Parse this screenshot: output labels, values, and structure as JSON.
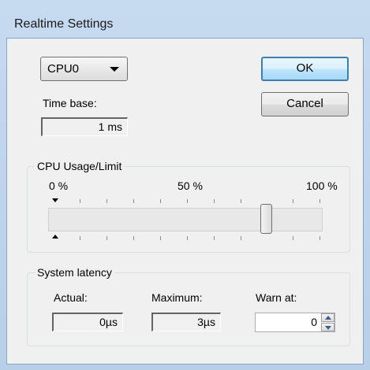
{
  "window": {
    "title": "Realtime Settings"
  },
  "cpu_select": {
    "selected": "CPU0"
  },
  "buttons": {
    "ok": "OK",
    "cancel": "Cancel"
  },
  "time_base": {
    "label": "Time base:",
    "value": "1 ms"
  },
  "cpu_usage": {
    "group_title": "CPU Usage/Limit",
    "scale_min": "0 %",
    "scale_mid": "50 %",
    "scale_max": "100 %",
    "limit_percent": 80
  },
  "latency": {
    "group_title": "System latency",
    "actual_label": "Actual:",
    "actual_value": "0µs",
    "maximum_label": "Maximum:",
    "maximum_value": "3µs",
    "warn_label": "Warn at:",
    "warn_value": "0"
  }
}
